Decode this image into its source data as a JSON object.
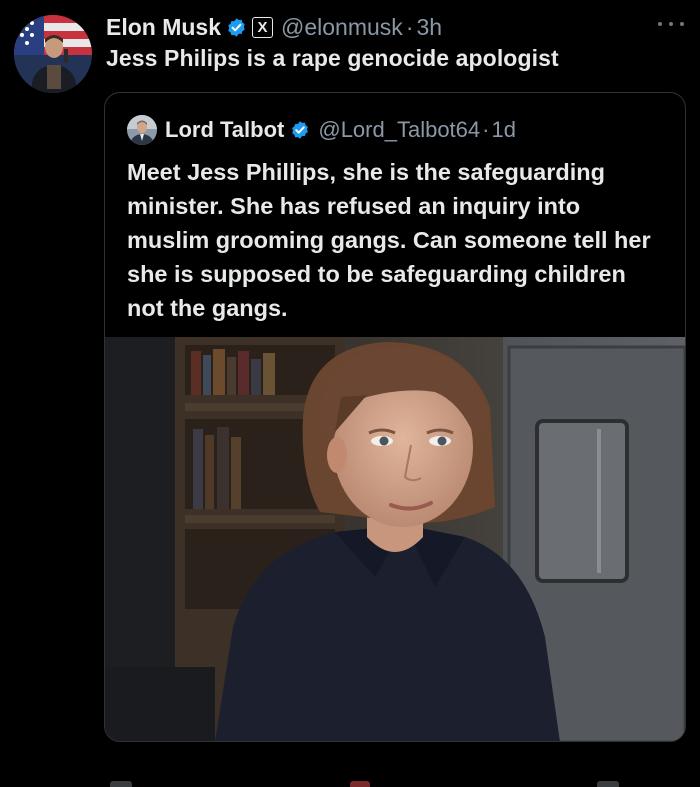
{
  "post": {
    "author_name": "Elon Musk",
    "x_badge": "X",
    "handle": "@elonmusk",
    "separator": "·",
    "time": "3h",
    "text": "Jess Philips is a rape genocide apologist"
  },
  "quoted_post": {
    "author_name": "Lord Talbot",
    "handle": "@Lord_Talbot64",
    "separator": "·",
    "time": "1d",
    "text": "Meet Jess Phillips, she is the safeguarding minister. She has refused an inquiry into muslim grooming gangs. Can someone tell her she is supposed to be safeguarding children not the gangs."
  },
  "icons": {
    "verified": "verified-badge-icon",
    "more": "more-options-icon"
  },
  "colors": {
    "background": "#000000",
    "text_primary": "#e7e9ea",
    "text_secondary": "#8b98a5",
    "verified_blue": "#1d9bf0",
    "border": "#2f3336"
  }
}
